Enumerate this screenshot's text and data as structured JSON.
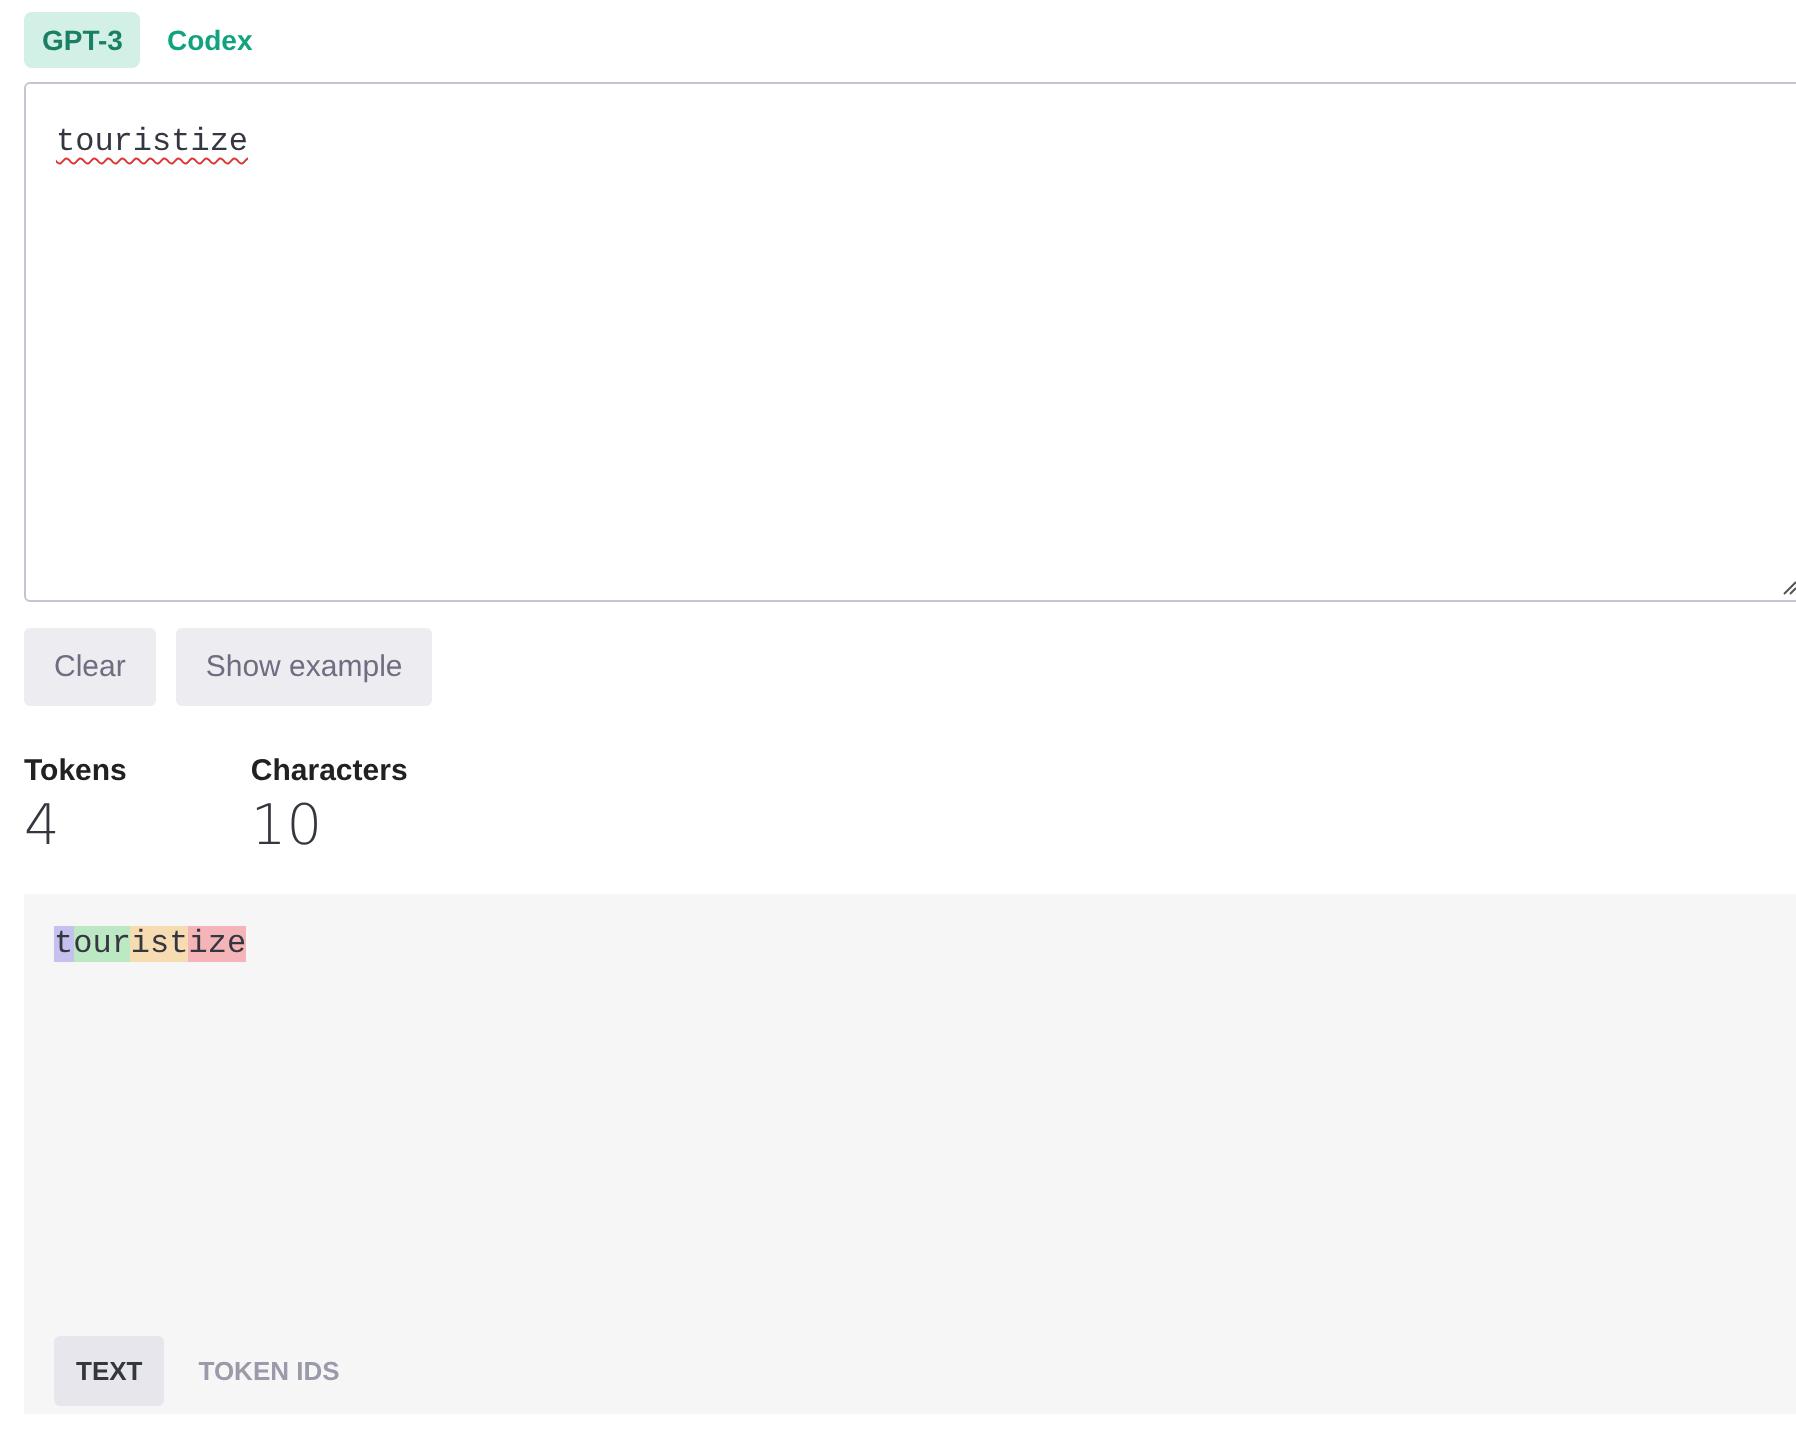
{
  "model_tabs": [
    {
      "label": "GPT-3",
      "selected": true
    },
    {
      "label": "Codex",
      "selected": false
    }
  ],
  "input": {
    "value": "touristize",
    "misspelled": true
  },
  "buttons": [
    "Clear",
    "Show example"
  ],
  "stats": [
    {
      "label": "Tokens",
      "value": "4"
    },
    {
      "label": "Characters",
      "value": "10"
    }
  ],
  "tokens": [
    {
      "text": "t",
      "color": "#c5c0ee"
    },
    {
      "text": "our",
      "color": "#bde8c4"
    },
    {
      "text": "ist",
      "color": "#f6dcb0"
    },
    {
      "text": "ize",
      "color": "#f4b4b8"
    }
  ],
  "view_tabs": [
    {
      "label": "TEXT",
      "selected": true
    },
    {
      "label": "TOKEN IDS",
      "selected": false
    }
  ]
}
